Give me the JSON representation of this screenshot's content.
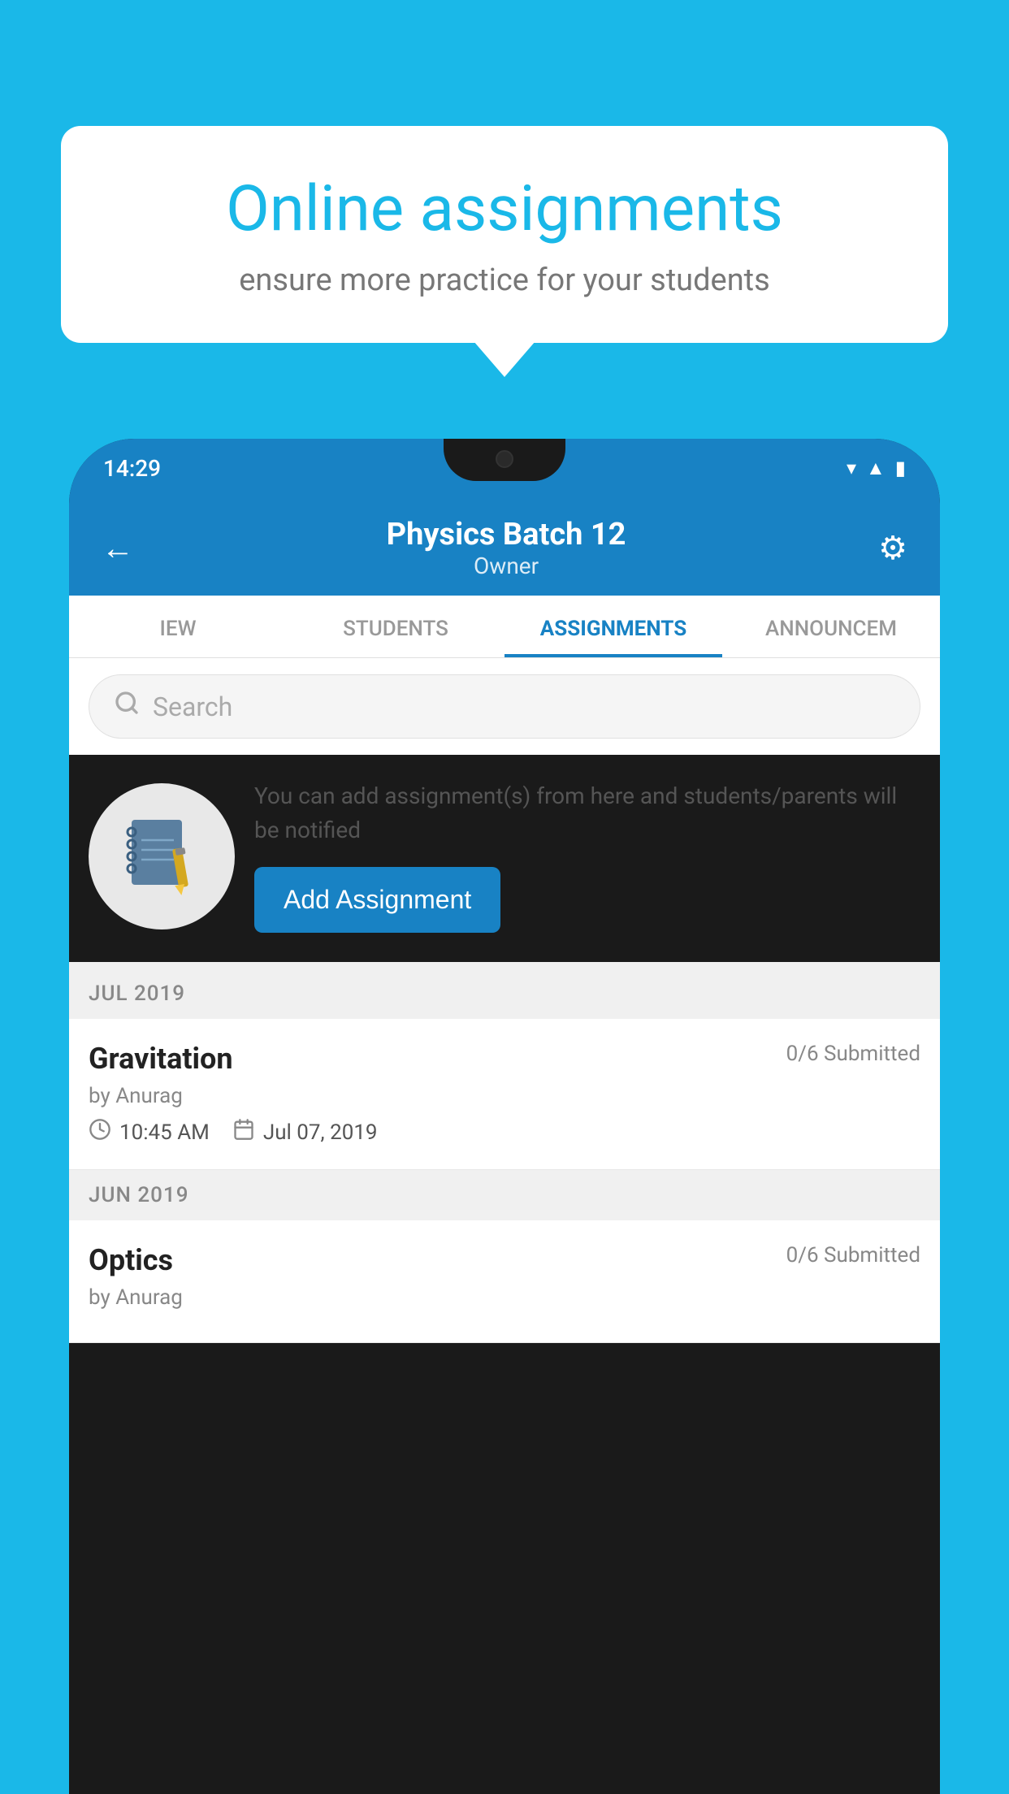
{
  "background_color": "#1AB8E8",
  "speech_bubble": {
    "title": "Online assignments",
    "subtitle": "ensure more practice for your students"
  },
  "phone": {
    "status_bar": {
      "time": "14:29",
      "icons": [
        "wifi",
        "signal",
        "battery"
      ]
    },
    "header": {
      "title": "Physics Batch 12",
      "subtitle": "Owner",
      "back_label": "←",
      "settings_label": "⚙"
    },
    "tabs": [
      {
        "label": "IEW",
        "active": false
      },
      {
        "label": "STUDENTS",
        "active": false
      },
      {
        "label": "ASSIGNMENTS",
        "active": true
      },
      {
        "label": "ANNOUNCEM",
        "active": false
      }
    ],
    "search": {
      "placeholder": "Search"
    },
    "promo": {
      "description": "You can add assignment(s) from here and students/parents will be notified",
      "button_label": "Add Assignment"
    },
    "sections": [
      {
        "month": "JUL 2019",
        "assignments": [
          {
            "name": "Gravitation",
            "submitted": "0/6 Submitted",
            "by": "by Anurag",
            "time": "10:45 AM",
            "date": "Jul 07, 2019"
          }
        ]
      },
      {
        "month": "JUN 2019",
        "assignments": [
          {
            "name": "Optics",
            "submitted": "0/6 Submitted",
            "by": "by Anurag",
            "time": "",
            "date": ""
          }
        ]
      }
    ]
  }
}
